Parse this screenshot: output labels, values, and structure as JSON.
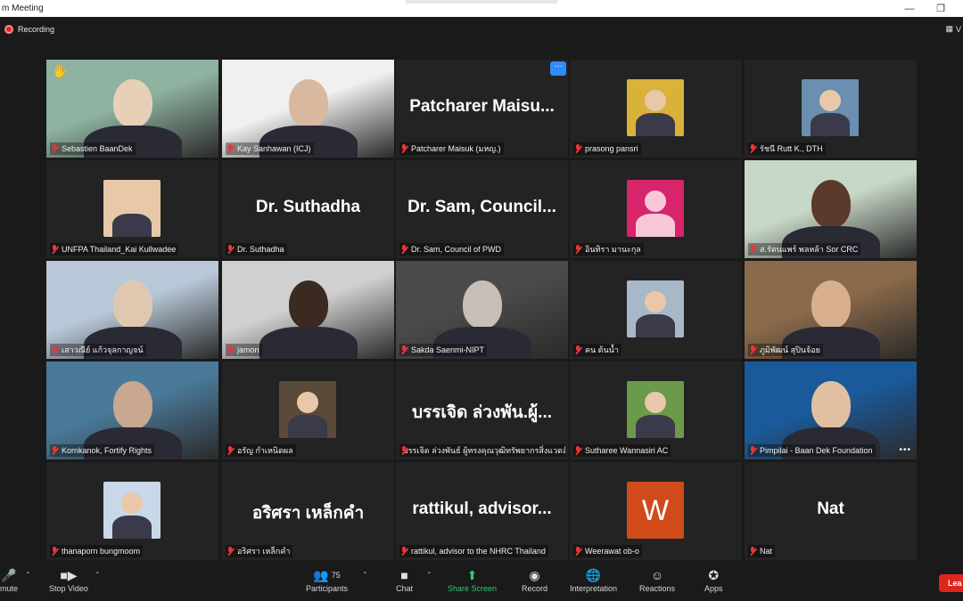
{
  "window": {
    "title": "m Meeting"
  },
  "topbar": {
    "recording_label": "Recording",
    "view_label": "V"
  },
  "participants": [
    {
      "name": "Sebastien BaanDek",
      "kind": "video",
      "raised_hand": true,
      "active": true
    },
    {
      "name": "Kay Sanhawan (ICJ)",
      "kind": "video"
    },
    {
      "name": "Patcharer Maisuk (มหญ.)",
      "kind": "name",
      "display": "Patcharer  Maisu...",
      "more_button": "···"
    },
    {
      "name": "prasong pansri",
      "kind": "avatar",
      "avatar_color": "#d9b23a"
    },
    {
      "name": "รัชนี Rutt K., DTH",
      "kind": "avatar",
      "avatar_color": "#6a8fb0"
    },
    {
      "name": "UNFPA Thailand_Kai Kullwadee",
      "kind": "avatar",
      "avatar_color": "#e8c8a8"
    },
    {
      "name": "Dr. Suthadha",
      "kind": "name",
      "display": "Dr. Suthadha"
    },
    {
      "name": "Dr. Sam, Council of PWD",
      "kind": "name",
      "display": "Dr. Sam,  Council..."
    },
    {
      "name": "อินทิรา มานะกุล",
      "kind": "avatar",
      "avatar_color": "#d8246b"
    },
    {
      "name": "ส.รัตนแพร์ พลหล้า Sor CRC",
      "kind": "video"
    },
    {
      "name": "เสาวณีย์ แก้วจุลกาญจน์",
      "kind": "video"
    },
    {
      "name": "jamon",
      "kind": "video"
    },
    {
      "name": "Sakda Saenmi-NIPT",
      "kind": "video"
    },
    {
      "name": "คน ต้นน้ำ",
      "kind": "avatar",
      "avatar_color": "#a7b8c8"
    },
    {
      "name": "ภูมิพัฒน์ สุปินจ้อย",
      "kind": "video"
    },
    {
      "name": "Kornkanok, Fortify Rights",
      "kind": "video"
    },
    {
      "name": "อรัญ กำเหนิดผล",
      "kind": "avatar",
      "avatar_color": "#5a4a3a"
    },
    {
      "name": "บรรเจิด ล่วงพันธ์ ผู้ทรงคุณวุฒิทรัพยากรสิ่งแวดล้อม",
      "kind": "name",
      "display": "บรรเจิด ล่วงพัน.ผู้..."
    },
    {
      "name": "Sutharee Wannasiri AC",
      "kind": "avatar",
      "avatar_color": "#6a9a4a"
    },
    {
      "name": "Pimpilai - Baan Dek Foundation",
      "kind": "video",
      "more_dots": "•••"
    },
    {
      "name": "thanaporn bungmoom",
      "kind": "avatar",
      "avatar_color": "#c8d8e8"
    },
    {
      "name": "อริศรา เหล็กคำ",
      "kind": "name",
      "display": "อริศรา เหล็กคำ"
    },
    {
      "name": "rattikul, advisor to the NHRC Thailand",
      "kind": "name",
      "display": "rattikul,  advisor..."
    },
    {
      "name": "Weerawat ob-o",
      "kind": "avatar",
      "avatar_color": "#d04a1a",
      "initial": "W"
    },
    {
      "name": "Nat",
      "kind": "name",
      "display": "Nat"
    }
  ],
  "toolbar": {
    "mute_label": "mute",
    "stop_video_label": "Stop Video",
    "participants_label": "Participants",
    "participants_count": "75",
    "chat_label": "Chat",
    "share_label": "Share Screen",
    "record_label": "Record",
    "interpretation_label": "Interpretation",
    "reactions_label": "Reactions",
    "apps_label": "Apps",
    "leave_label": "Lea"
  },
  "colors": {
    "active_speaker": "#d6e85a",
    "share_green": "#2ecc71",
    "leave_red": "#e0251b",
    "bg": "#1a1a1a"
  }
}
